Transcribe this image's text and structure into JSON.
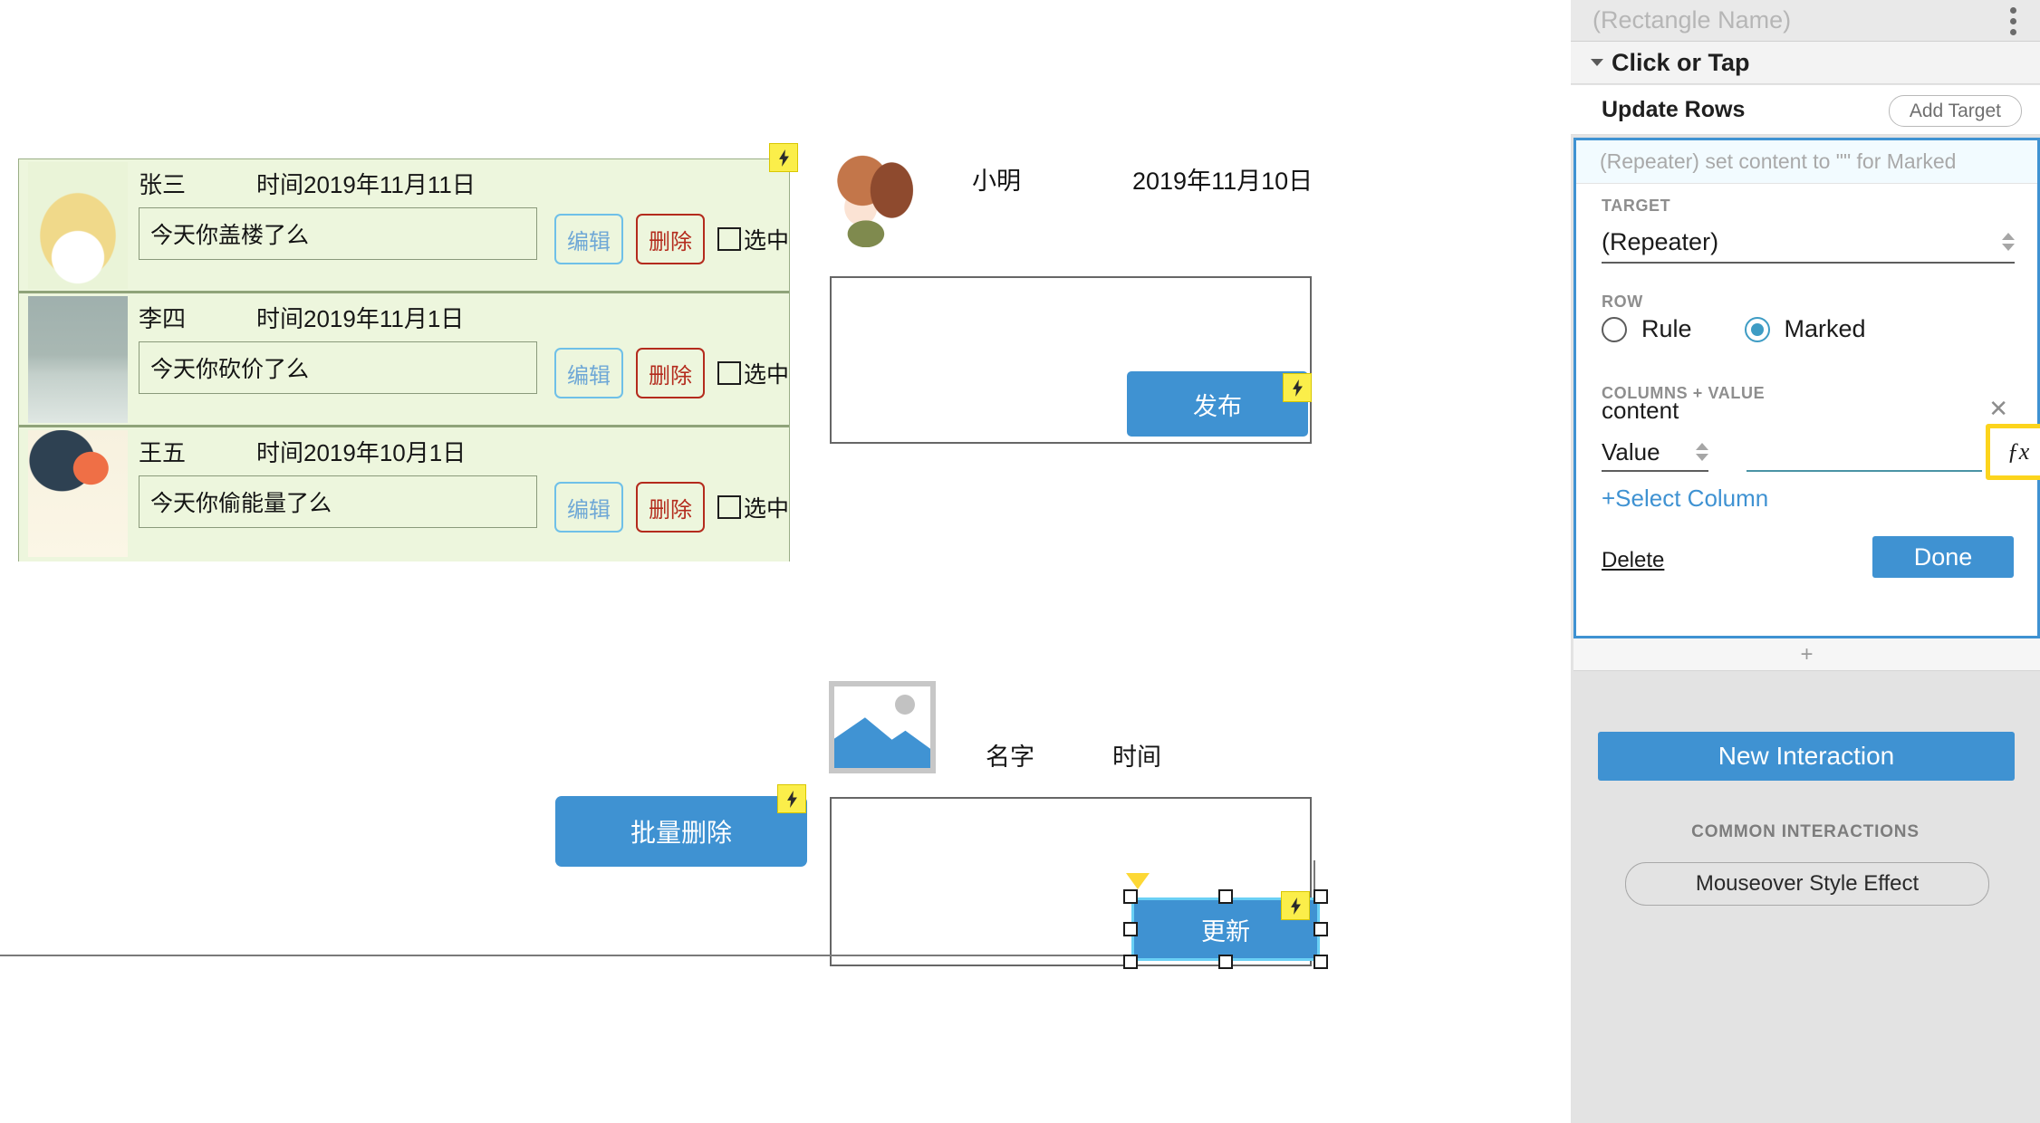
{
  "canvas": {
    "repeater": {
      "rows": [
        {
          "name": "张三",
          "time": "时间2019年11月11日",
          "content": "今天你盖楼了么",
          "edit_label": "编辑",
          "delete_label": "删除",
          "check_label": "选中"
        },
        {
          "name": "李四",
          "time": "时间2019年11月1日",
          "content": "今天你砍价了么",
          "edit_label": "编辑",
          "delete_label": "删除",
          "check_label": "选中"
        },
        {
          "name": "王五",
          "time": "时间2019年10月1日",
          "content": "今天你偷能量了么",
          "edit_label": "编辑",
          "delete_label": "删除",
          "check_label": "选中"
        }
      ],
      "bolt_icon": "lightning-bolt-icon"
    },
    "post": {
      "name": "小明",
      "date": "2019年11月10日",
      "publish_label": "发布",
      "bolt_icon": "lightning-bolt-icon"
    },
    "bottom": {
      "batch_delete_label": "批量删除",
      "name_label": "名字",
      "time_label": "时间",
      "update_label": "更新",
      "image_placeholder_icon": "image-placeholder-icon",
      "bolt_icon": "lightning-bolt-icon"
    }
  },
  "panel": {
    "title": "(Rectangle Name)",
    "kebab_icon": "more-options-icon",
    "event": {
      "label": "Click or Tap",
      "caret_icon": "caret-down-icon"
    },
    "action": {
      "label": "Update Rows",
      "add_target_label": "Add Target"
    },
    "edit_card": {
      "summary": "(Repeater) set content to \"\" for Marked",
      "target_section_label": "TARGET",
      "target_value": "(Repeater)",
      "row_section_label": "ROW",
      "row_options": [
        {
          "label": "Rule",
          "selected": false
        },
        {
          "label": "Marked",
          "selected": true
        }
      ],
      "columns_section_label": "COLUMNS + VALUE",
      "column_name": "content",
      "remove_icon": "close-icon",
      "value_type": "Value",
      "value_text": "",
      "fx_label": "ƒx",
      "select_column_label": "+Select Column",
      "delete_label": "Delete",
      "done_label": "Done"
    },
    "add_strip": "+",
    "new_interaction_label": "New Interaction",
    "common_interactions_label": "COMMON INTERACTIONS",
    "mouseover_label": "Mouseover Style Effect"
  },
  "colors": {
    "accent_blue": "#3f92d2",
    "list_bg": "#edf6dd",
    "bolt_yellow": "#fbee4a",
    "highlight_yellow": "#fcd41c",
    "danger_red": "#b42b1d"
  }
}
